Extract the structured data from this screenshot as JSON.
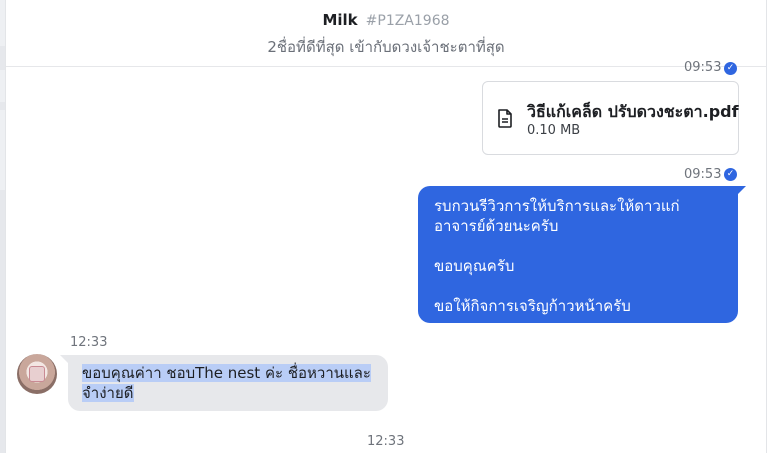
{
  "header": {
    "name": "Milk",
    "code": "#P1ZA1968",
    "subtitle": "2ชื่อที่ดีที่สุด เข้ากับดวงเจ้าชะตาที่สุด"
  },
  "messages": {
    "file_time": "09:53",
    "file": {
      "name": "วิธีแก้เคล็ด ปรับดวงชะตา.pdf",
      "size": "0.10 MB",
      "icon": "file-icon"
    },
    "outgoing_time": "09:53",
    "outgoing_lines": [
      "รบกวนรีวิวการให้บริการและให้ดาวแก่",
      "อาจารย์ด้วยนะครับ",
      "",
      "ขอบคุณครับ",
      "",
      "ขอให้กิจการเจริญก้าวหน้าครับ"
    ],
    "incoming_time": "12:33",
    "incoming_lines": [
      "ขอบคุณค่าา ชอบThe nest ค่ะ ชื่อหวานและ",
      "จำง่ายดี"
    ],
    "bottom_time": "12:33"
  },
  "colors": {
    "accent": "#2f66e0",
    "incoming_bubble": "#e7e8eb",
    "selection": "#b9cdf6"
  }
}
